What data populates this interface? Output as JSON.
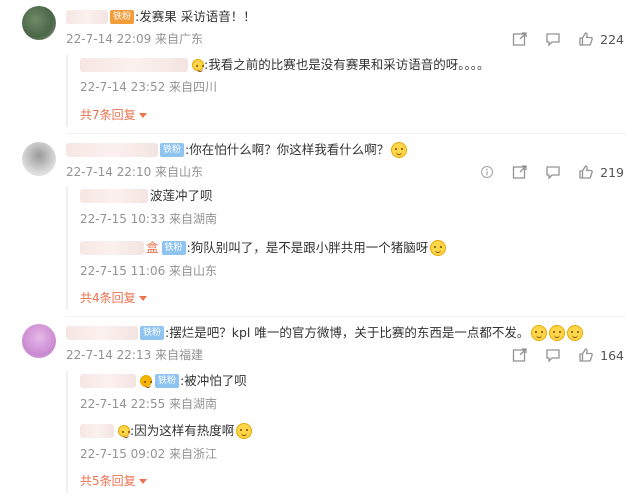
{
  "comments": [
    {
      "text": ":发赛果 采访语音！！",
      "badge": "铁粉",
      "time": "22-7-14 22:09 来自广东",
      "likes": "224",
      "replies": [
        {
          "text": ":我看之前的比赛也是没有赛果和采访语音的呀。。。。",
          "time": "22-7-14 23:52 来自四川"
        }
      ],
      "more": "共7条回复"
    },
    {
      "text": ":你在怕什么啊？你这样我看什么啊？",
      "badge": "铁粉",
      "time": "22-7-14 22:10 来自山东",
      "likes": "219",
      "replies": [
        {
          "text": "波莲冲了呗",
          "time": "22-7-15 10:33 来自湖南"
        },
        {
          "name_suffix": "盒",
          "badge": "铁粉",
          "text": ":狗队别叫了，是不是跟小胖共用一个猪脑呀",
          "time": "22-7-15 11:06 来自山东"
        }
      ],
      "more": "共4条回复"
    },
    {
      "text": ":摆烂是吧？kpl 唯一的官方微博，关于比赛的东西是一点都不发。",
      "badge": "铁粉",
      "time": "22-7-14 22:13 来自福建",
      "likes": "164",
      "replies": [
        {
          "badge": "铁粉",
          "text": ":被冲怕了呗",
          "time": "22-7-14 22:55 来自湖南"
        },
        {
          "text": ":因为这样有热度啊",
          "time": "22-7-15 09:02 来自浙江"
        }
      ],
      "more": "共5条回复"
    }
  ]
}
